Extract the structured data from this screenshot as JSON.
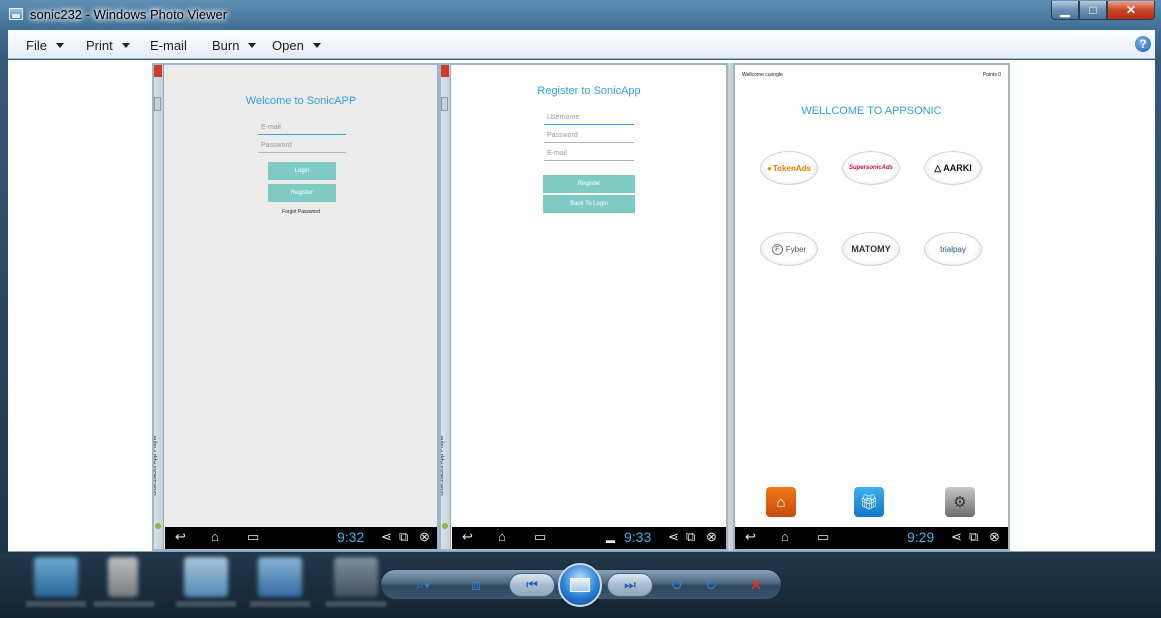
{
  "window": {
    "title": "sonic232 - Windows Photo Viewer",
    "minimize_label": "▁",
    "maximize_label": "□",
    "close_label": "✕"
  },
  "menu": {
    "file": "File",
    "print": "Print",
    "email": "E-mail",
    "burn": "Burn",
    "open": "Open",
    "help": "?"
  },
  "screens": {
    "login": {
      "title": "Welcome to SonicAPP",
      "email_placeholder": "E-mail",
      "password_placeholder": "Password",
      "login_button": "Login",
      "register_button": "Register",
      "forgot_link": "Forgot Password",
      "time": "9:32",
      "side_label": "BlueStacks App Player"
    },
    "register": {
      "title": "Register to  SonicApp",
      "username_placeholder": "Username",
      "password_placeholder": "Password",
      "email_placeholder": "E-mail",
      "register_button": "Register",
      "back_button": "Back To Login",
      "time": "9:33",
      "side_label": "BlueStacks App Player"
    },
    "home": {
      "welcome_user": "Wellcome cuongle",
      "points": "Points  0",
      "title": "WELLCOME TO APPSONIC",
      "offerwalls": [
        "TokenAds",
        "SupersonicAds",
        "AARKI",
        "Fyber",
        "MATOMY",
        "trialpay"
      ],
      "time": "9:29"
    }
  },
  "controls": {
    "zoom": "⌕▾",
    "fit": "⧈",
    "previous": "⏮",
    "next": "⏭",
    "rotate_ccw": "↺",
    "rotate_cw": "↻",
    "delete": "✕"
  },
  "colors": {
    "android_accent": "#33a0e2",
    "button_teal": "#7ecbc5",
    "delete_red": "#d8332a"
  }
}
